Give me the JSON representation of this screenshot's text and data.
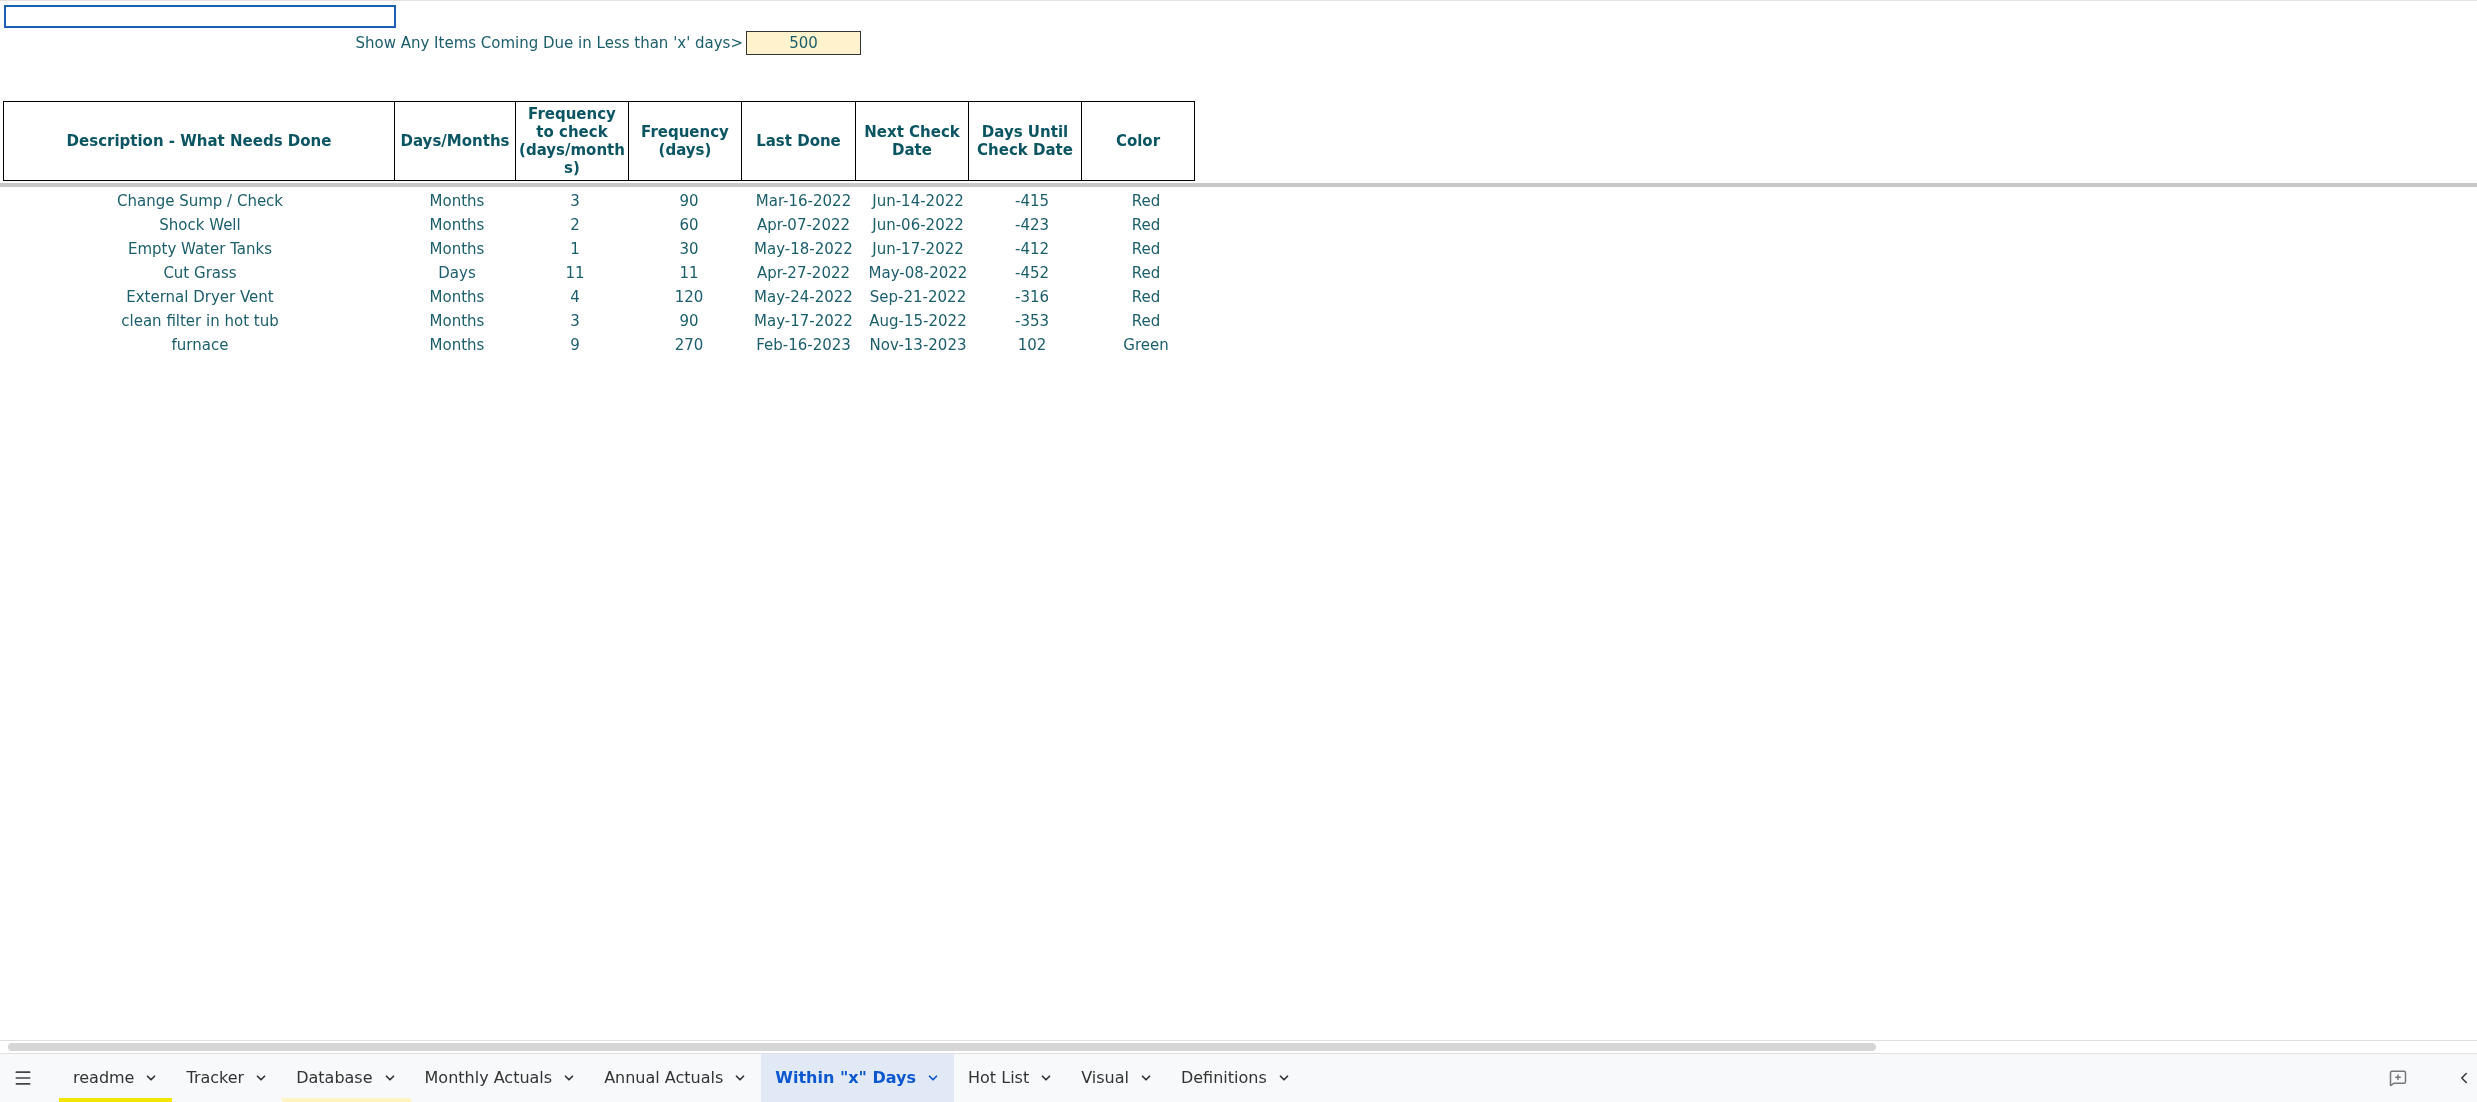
{
  "filter": {
    "label": "Show Any Items Coming Due in Less than 'x' days>",
    "value": "500"
  },
  "table": {
    "columns": [
      "Description - What Needs Done",
      "Days/Months",
      "Frequency to check (days/months)",
      "Frequency (days)",
      "Last Done",
      "Next Check Date",
      "Days Until Check Date",
      "Color"
    ],
    "rows": [
      [
        "Change Sump / Check",
        "Months",
        "3",
        "90",
        "Mar-16-2022",
        "Jun-14-2022",
        "-415",
        "Red"
      ],
      [
        "Shock Well",
        "Months",
        "2",
        "60",
        "Apr-07-2022",
        "Jun-06-2022",
        "-423",
        "Red"
      ],
      [
        "Empty Water Tanks",
        "Months",
        "1",
        "30",
        "May-18-2022",
        "Jun-17-2022",
        "-412",
        "Red"
      ],
      [
        "Cut Grass",
        "Days",
        "11",
        "11",
        "Apr-27-2022",
        "May-08-2022",
        "-452",
        "Red"
      ],
      [
        "External Dryer Vent",
        "Months",
        "4",
        "120",
        "May-24-2022",
        "Sep-21-2022",
        "-316",
        "Red"
      ],
      [
        "clean filter in hot tub",
        "Months",
        "3",
        "90",
        "May-17-2022",
        "Aug-15-2022",
        "-353",
        "Red"
      ],
      [
        "furnace",
        "Months",
        "9",
        "270",
        "Feb-16-2023",
        "Nov-13-2023",
        "102",
        "Green"
      ]
    ]
  },
  "sheet_tabs": [
    {
      "label": "readme",
      "selected": false,
      "color": "#f2e600"
    },
    {
      "label": "Tracker",
      "selected": false
    },
    {
      "label": "Database",
      "selected": false,
      "color": "#fff4c2"
    },
    {
      "label": "Monthly Actuals",
      "selected": false
    },
    {
      "label": "Annual Actuals",
      "selected": false
    },
    {
      "label": "Within \"x\" Days",
      "selected": true
    },
    {
      "label": "Hot List",
      "selected": false
    },
    {
      "label": "Visual",
      "selected": false
    },
    {
      "label": "Definitions",
      "selected": false
    }
  ]
}
